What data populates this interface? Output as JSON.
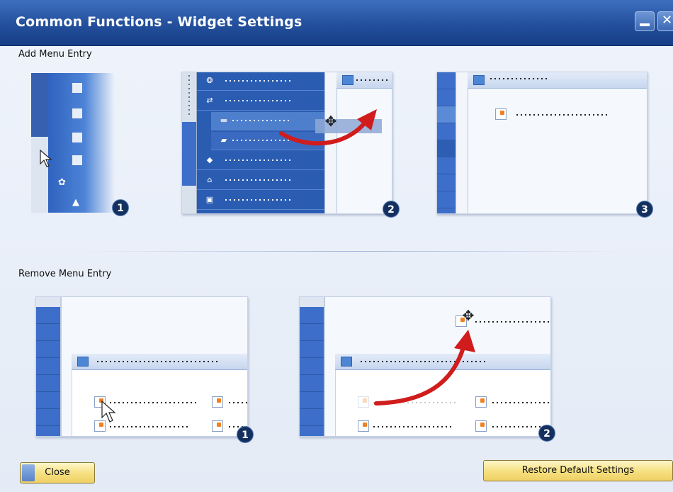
{
  "window": {
    "title": "Common Functions - Widget Settings",
    "minimize_icon": "minimize-icon",
    "close_icon": "close-icon",
    "close_glyph": "✕"
  },
  "add_section": {
    "label": "Add Menu Entry",
    "steps": [
      "1",
      "2",
      "3"
    ]
  },
  "remove_section": {
    "label": "Remove Menu Entry",
    "steps": [
      "1",
      "2"
    ]
  },
  "buttons": {
    "close": "Close",
    "restore": "Restore Default Settings"
  },
  "colors": {
    "title_bar": "#234f9c",
    "menu_blue": "#2a5cb2",
    "button_gold": "#f5df7f",
    "arrow_red": "#d01c1c"
  }
}
